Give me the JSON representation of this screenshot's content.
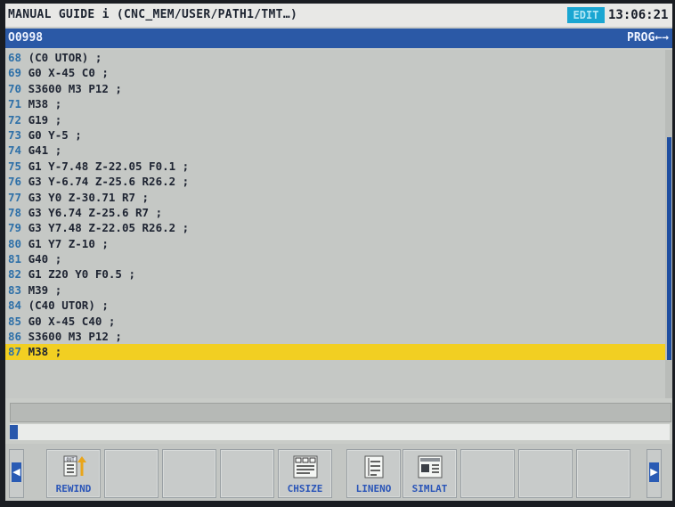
{
  "header": {
    "title": "MANUAL GUIDE i (CNC_MEM/USER/PATH1/TMT…)",
    "mode": "EDIT",
    "clock": "13:06:21"
  },
  "program": {
    "number": "O0998",
    "tag": "PROG←→"
  },
  "lines": [
    {
      "num": "68",
      "code": "(C0 UTOR) ;"
    },
    {
      "num": "69",
      "code": "G0 X-45 C0 ;"
    },
    {
      "num": "70",
      "code": "S3600 M3 P12 ;"
    },
    {
      "num": "71",
      "code": "M38 ;"
    },
    {
      "num": "72",
      "code": "G19 ;"
    },
    {
      "num": "73",
      "code": "G0 Y-5 ;"
    },
    {
      "num": "74",
      "code": "G41 ;"
    },
    {
      "num": "75",
      "code": "G1 Y-7.48 Z-22.05 F0.1 ;"
    },
    {
      "num": "76",
      "code": "G3 Y-6.74 Z-25.6 R26.2 ;"
    },
    {
      "num": "77",
      "code": "G3 Y0 Z-30.71 R7 ;"
    },
    {
      "num": "78",
      "code": "G3 Y6.74 Z-25.6 R7 ;"
    },
    {
      "num": "79",
      "code": "G3 Y7.48 Z-22.05 R26.2 ;"
    },
    {
      "num": "80",
      "code": "G1 Y7 Z-10 ;"
    },
    {
      "num": "81",
      "code": "G40 ;"
    },
    {
      "num": "82",
      "code": "G1 Z20 Y0 F0.5 ;"
    },
    {
      "num": "83",
      "code": "M39 ;"
    },
    {
      "num": "84",
      "code": "(C40 UTOR) ;"
    },
    {
      "num": "85",
      "code": "G0 X-45 C40 ;"
    },
    {
      "num": "86",
      "code": "S3600 M3 P12 ;"
    },
    {
      "num": "87",
      "code": "M38 ;",
      "active": true
    }
  ],
  "softkeys": {
    "rewind": "REWIND",
    "chsize": "CHSIZE",
    "lineno": "LINENO",
    "simlat": "SIMLAT",
    "rewind_icon_text": "OUT"
  },
  "colors": {
    "mode_bg": "#1aa6d2",
    "prog_bar": "#2b59a6",
    "active_line": "#f2cf22",
    "softkey_label": "#2a55b8"
  }
}
